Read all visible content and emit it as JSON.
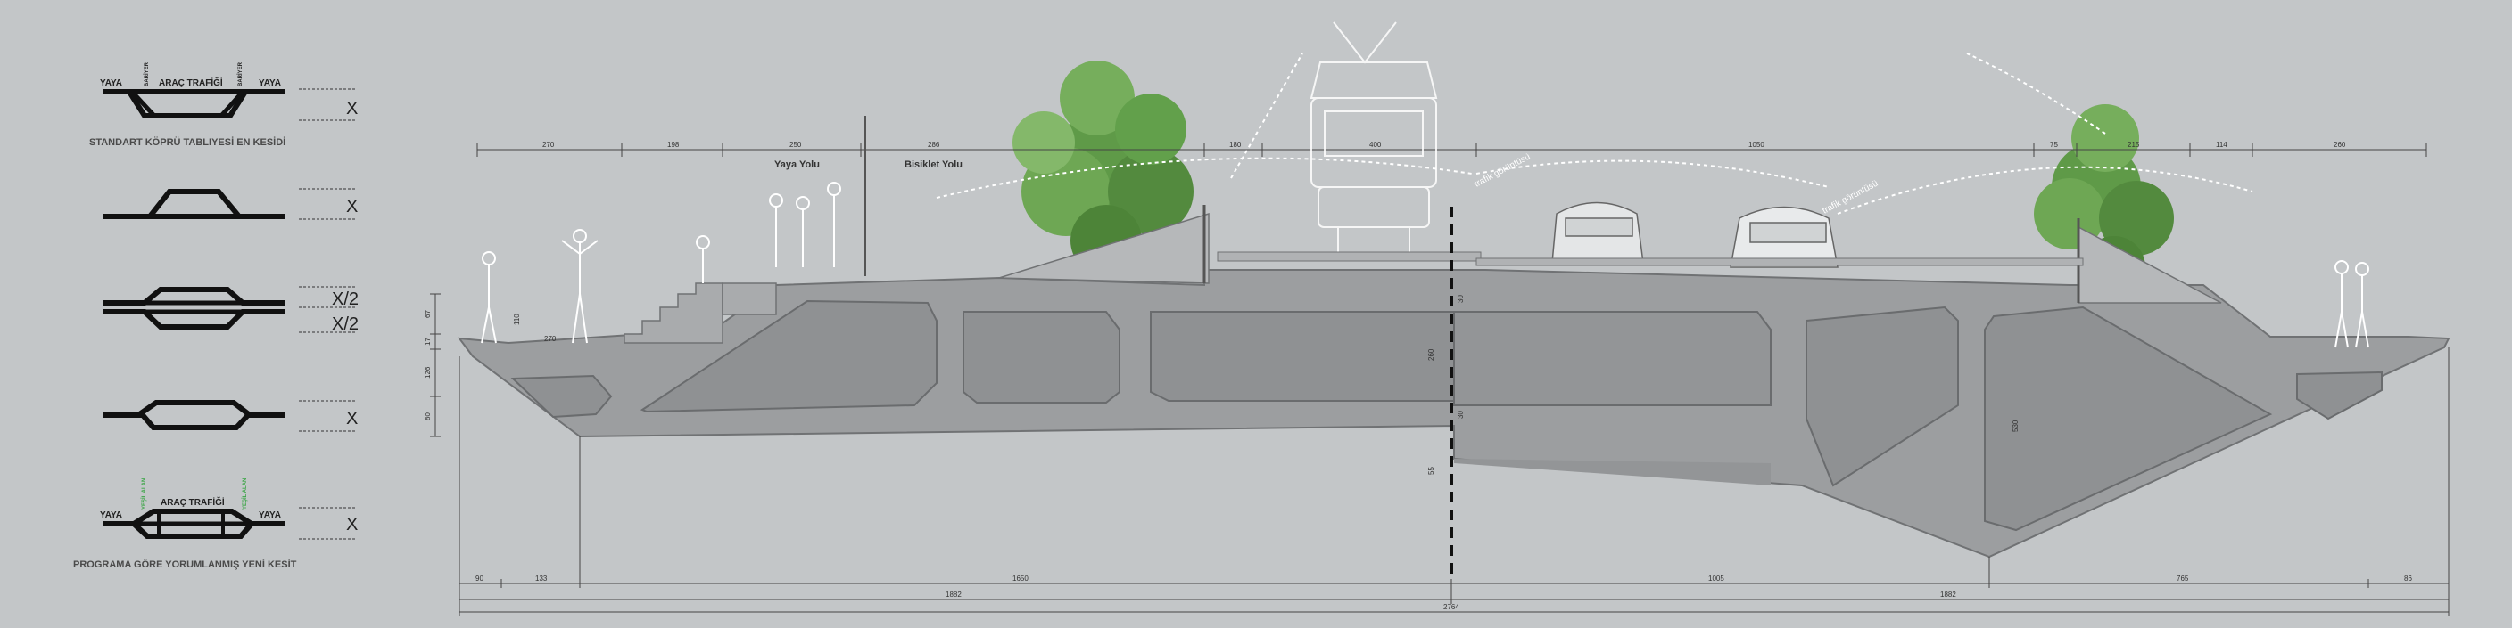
{
  "legend": {
    "title": "STANDART KÖPRÜ TABLIYESİ EN KESİDİ",
    "bottom_title": "PROGRAMA GÖRE YORUMLANMIŞ YENİ KESİT",
    "top_labels": [
      "YAYA",
      "ARAÇ TRAFİĞİ",
      "YAYA"
    ],
    "bottom_labels": [
      "YAYA",
      "ARAÇ TRAFİĞİ",
      "YAYA"
    ],
    "bariyer": "BARİYER",
    "vert_green": "YEŞİL ALAN",
    "marks": [
      "X",
      "X",
      "X/2",
      "X/2",
      "X",
      "X"
    ],
    "green_color": "#3aa545"
  },
  "section": {
    "labels": {
      "yaya_yolu": "Yaya Yolu",
      "bisiklet_yolu": "Bisiklet Yolu"
    },
    "annotations": [
      "trafik görüntüsü",
      "trafik görüntüsü"
    ],
    "top_dims": [
      "270",
      "198",
      "250",
      "286",
      "180",
      "400",
      "1050",
      "75",
      "215",
      "114",
      "260"
    ],
    "side_dims": [
      "67",
      "17",
      "126",
      "80"
    ],
    "inner_dims": [
      "270",
      "110",
      "30",
      "260",
      "30",
      "55",
      "530"
    ],
    "bottom_dims": [
      "90",
      "133",
      "1650",
      "1005",
      "765",
      "86"
    ],
    "total_halves": [
      "1882",
      "1882"
    ],
    "total": "2764",
    "colors": {
      "deck": "#9c9ea0",
      "deck_outline": "#707274",
      "void": "#8f9193",
      "bg": "#c3c6c8",
      "tree": "#5f9a48"
    }
  }
}
